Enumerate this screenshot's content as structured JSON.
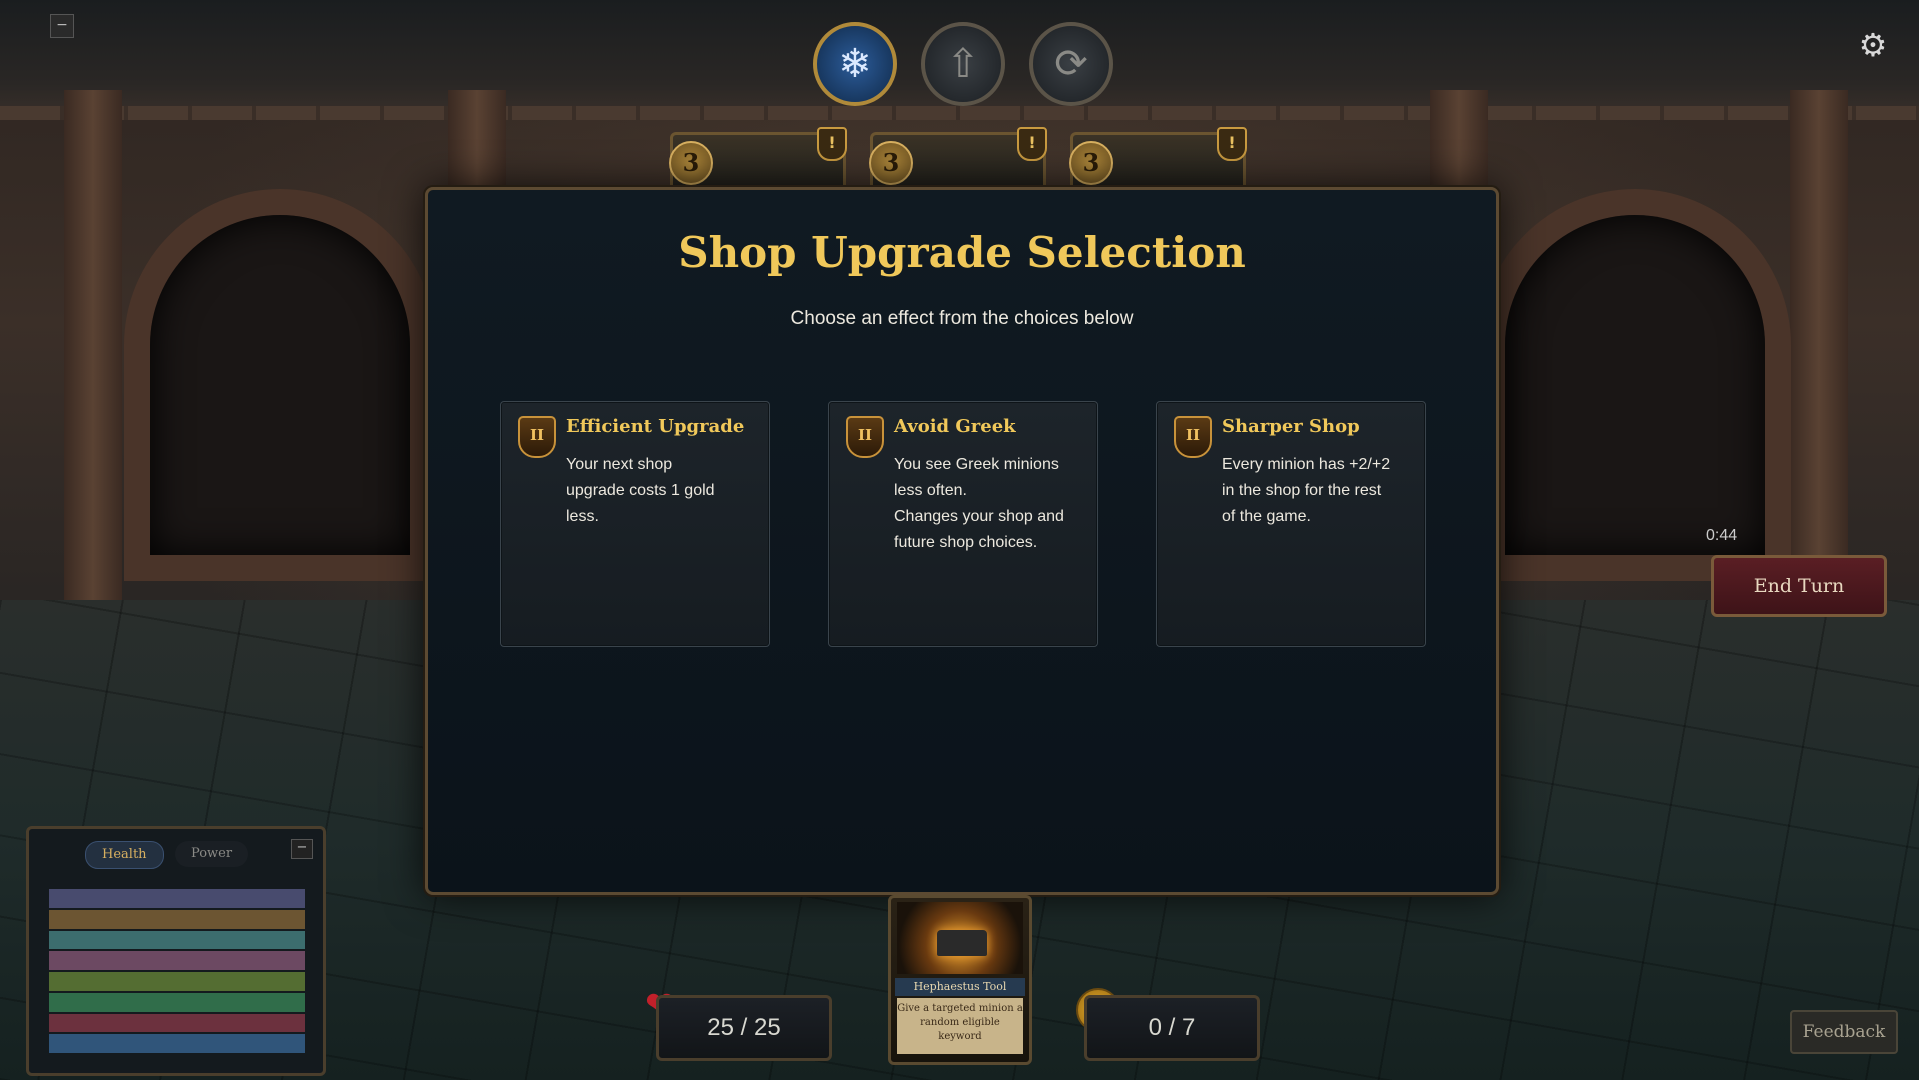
{
  "top_controls": {
    "freeze_icon": "snowflake-icon",
    "upgrade_icon": "up-arrow-icon",
    "refresh_icon": "refresh-icon",
    "settings_icon": "gear-icon",
    "minimize_label": "−"
  },
  "shop_cards": [
    {
      "cost": "3",
      "alert": "!"
    },
    {
      "cost": "3",
      "alert": "!"
    },
    {
      "cost": "3",
      "alert": "!"
    }
  ],
  "modal": {
    "title": "Shop Upgrade Selection",
    "subtitle": "Choose an effect from the choices below",
    "choices": [
      {
        "tier": "II",
        "title": "Efficient Upgrade",
        "description": "Your next shop\nupgrade costs 1 gold\nless."
      },
      {
        "tier": "II",
        "title": "Avoid Greek",
        "description": "You see Greek minions\nless often.\nChanges your shop and\nfuture shop choices."
      },
      {
        "tier": "II",
        "title": "Sharper Shop",
        "description": "Every minion has +2/+2\nin the shop for the rest\nof the game."
      }
    ]
  },
  "turn": {
    "timer": "0:44",
    "end_turn_label": "End Turn"
  },
  "stats_panel": {
    "tabs": [
      "Health",
      "Power"
    ],
    "active_tab": "Health",
    "minimize_label": "−",
    "stripe_colors": [
      "#5a5c8a",
      "#8a6a3a",
      "#4a8a8a",
      "#8a5a7a",
      "#6a8a3a",
      "#3a8a5a",
      "#8a3a4a",
      "#3a6a9a"
    ]
  },
  "hud": {
    "health": "25 / 25",
    "gold": "0 / 7"
  },
  "hand_card": {
    "name": "Hephaestus Tool",
    "text": "Give a targeted minion a random eligible keyword"
  },
  "feedback_label": "Feedback"
}
